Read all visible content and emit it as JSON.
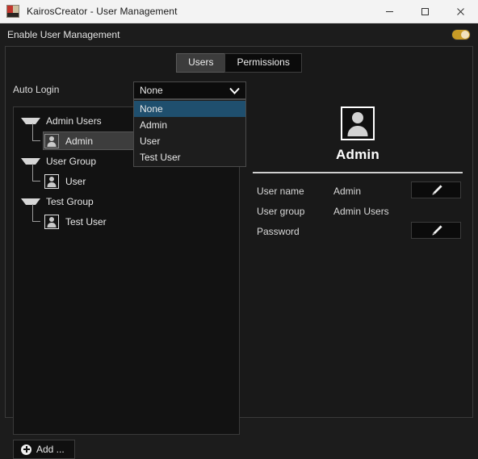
{
  "window": {
    "title": "KairosCreator - User Management",
    "icon": "app-icon",
    "controls": {
      "minimize": "minimize-icon",
      "maximize": "maximize-icon",
      "close": "close-icon"
    }
  },
  "enable_bar": {
    "label": "Enable User Management",
    "toggle_on": true,
    "toggle_color": "#c89b26"
  },
  "tabs": [
    {
      "label": "Users",
      "active": true
    },
    {
      "label": "Permissions",
      "active": false
    }
  ],
  "auto_login": {
    "label": "Auto Login",
    "selected": "None",
    "open": true,
    "options": [
      {
        "label": "None",
        "selected": true
      },
      {
        "label": "Admin",
        "selected": false
      },
      {
        "label": "User",
        "selected": false
      },
      {
        "label": "Test User",
        "selected": false
      }
    ],
    "highlight_color": "#1f4f6e"
  },
  "tree": {
    "groups": [
      {
        "label": "Admin Users",
        "children": [
          {
            "label": "Admin",
            "selected": true
          }
        ]
      },
      {
        "label": "User Group",
        "children": [
          {
            "label": "User",
            "selected": false
          }
        ]
      },
      {
        "label": "Test Group",
        "children": [
          {
            "label": "Test User",
            "selected": false
          }
        ]
      }
    ]
  },
  "add_button": {
    "label": "Add ..."
  },
  "detail": {
    "avatar": "user-avatar-icon",
    "name": "Admin",
    "fields": [
      {
        "label": "User name",
        "value": "Admin",
        "has_edit": true
      },
      {
        "label": "User group",
        "value": "Admin Users",
        "has_edit": false
      },
      {
        "label": "Password",
        "value": "",
        "has_edit": true
      }
    ],
    "edit_icon": "pencil-icon"
  }
}
